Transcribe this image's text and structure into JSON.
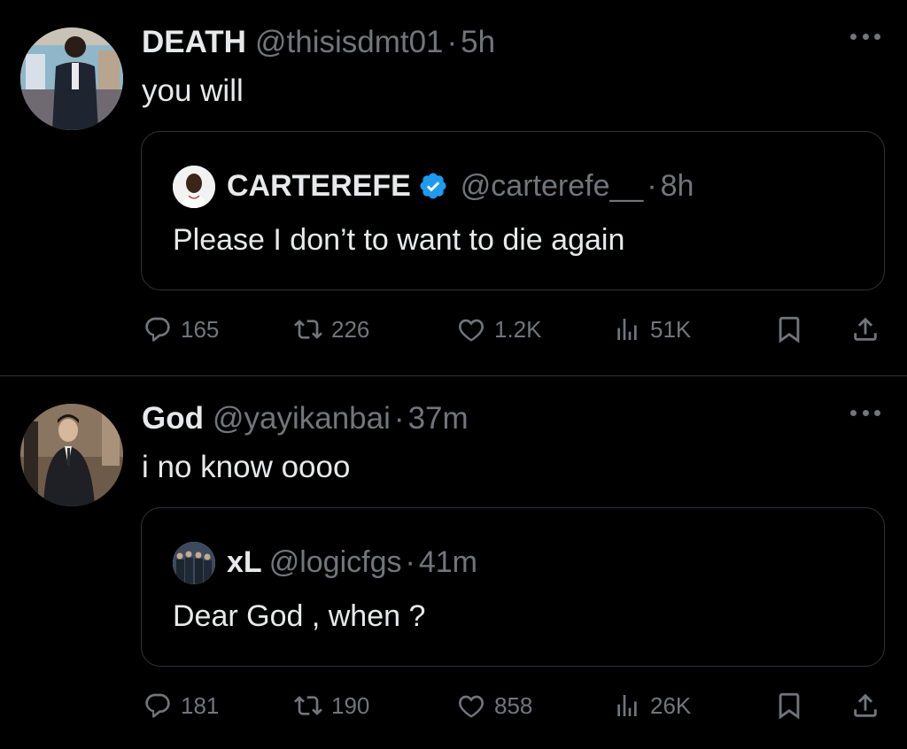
{
  "tweets": [
    {
      "author_name": "DEATH",
      "handle": "@thisisdmt01",
      "separator": "·",
      "time": "5h",
      "text": "you will",
      "quote": {
        "author_name": "CARTEREFE",
        "verified": true,
        "handle": "@carterefe__",
        "separator": "·",
        "time": "8h",
        "text": "Please I don’t to want to die again"
      },
      "stats": {
        "replies": "165",
        "reposts": "226",
        "likes": "1.2K",
        "views": "51K"
      }
    },
    {
      "author_name": "God",
      "handle": "@yayikanbai",
      "separator": "·",
      "time": "37m",
      "text": "i no know oooo",
      "quote": {
        "author_name": "xL",
        "verified": false,
        "handle": "@logicfgs",
        "separator": "·",
        "time": "41m",
        "text": "Dear God , when ?"
      },
      "stats": {
        "replies": "181",
        "reposts": "190",
        "likes": "858",
        "views": "26K"
      }
    }
  ],
  "icons": {
    "reply": "reply-icon",
    "repost": "repost-icon",
    "like": "heart-icon",
    "views": "views-icon",
    "bookmark": "bookmark-icon",
    "share": "share-icon",
    "more": "more-icon",
    "verified": "verified-badge-icon"
  },
  "colors": {
    "background": "#000000",
    "text_primary": "#e7e9ea",
    "text_secondary": "#71767b",
    "border": "#2f3336",
    "verified_blue": "#1d9bf0"
  }
}
